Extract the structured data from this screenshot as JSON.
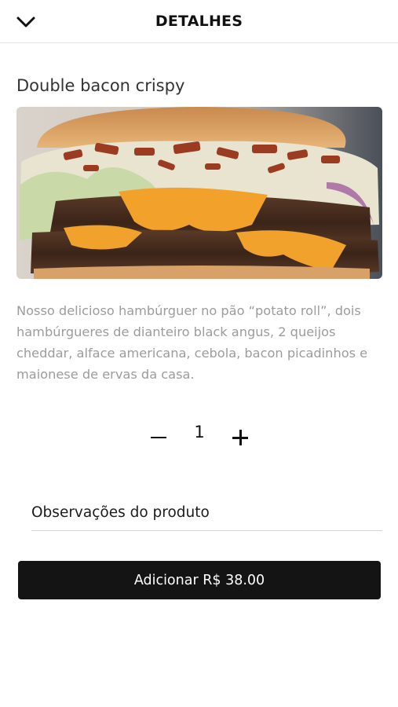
{
  "header": {
    "title": "DETALHES",
    "back_icon": "chevron-down-icon"
  },
  "product": {
    "name": "Double bacon crispy",
    "image_subject": "burger-photo",
    "description": "Nosso delicioso hambúrguer no pão “potato roll”, dois hambúrgueres de dianteiro black angus, 2 queijos cheddar, alface americana, cebola, bacon picadinhos e maionese de ervas da casa."
  },
  "quantity": {
    "value": "1",
    "minus_icon": "minus-icon",
    "plus_icon": "plus-icon"
  },
  "observations": {
    "placeholder": "Observações do produto",
    "value": ""
  },
  "add_button": {
    "label": "Adicionar R$ 38.00"
  },
  "colors": {
    "button_bg": "#141414",
    "description_text": "#9c9c9c",
    "divider": "#e6e6e6"
  }
}
